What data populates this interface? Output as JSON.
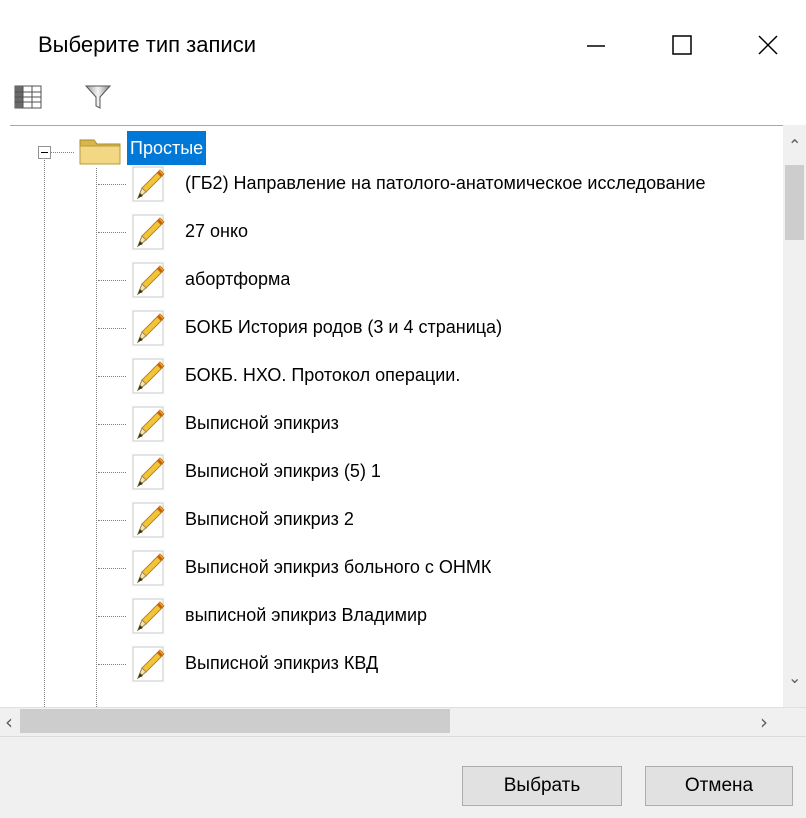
{
  "window": {
    "title": "Выберите тип записи"
  },
  "tree": {
    "root": {
      "label": "Простые"
    },
    "items": [
      {
        "label": "(ГБ2) Направление на патолого-анатомическое исследование"
      },
      {
        "label": "27 онко"
      },
      {
        "label": "абортформа"
      },
      {
        "label": "БОКБ История родов (3 и 4 страница)"
      },
      {
        "label": "БОКБ. НХО. Протокол операции."
      },
      {
        "label": "Выписной эпикриз"
      },
      {
        "label": "Выписной эпикриз (5) 1"
      },
      {
        "label": "Выписной эпикриз 2"
      },
      {
        "label": "Выписной эпикриз больного с ОНМК"
      },
      {
        "label": "выписной эпикриз Владимир"
      },
      {
        "label": "Выписной эпикриз КВД"
      }
    ]
  },
  "footer": {
    "select_label": "Выбрать",
    "cancel_label": "Отмена"
  },
  "colors": {
    "selection": "#0078d7",
    "footer_bg": "#f0f0f0",
    "button_bg": "#e1e1e1"
  },
  "icons": [
    "columns-icon",
    "filter-icon",
    "folder-icon",
    "pencil-document-icon",
    "minimize-icon",
    "maximize-icon",
    "close-icon"
  ]
}
